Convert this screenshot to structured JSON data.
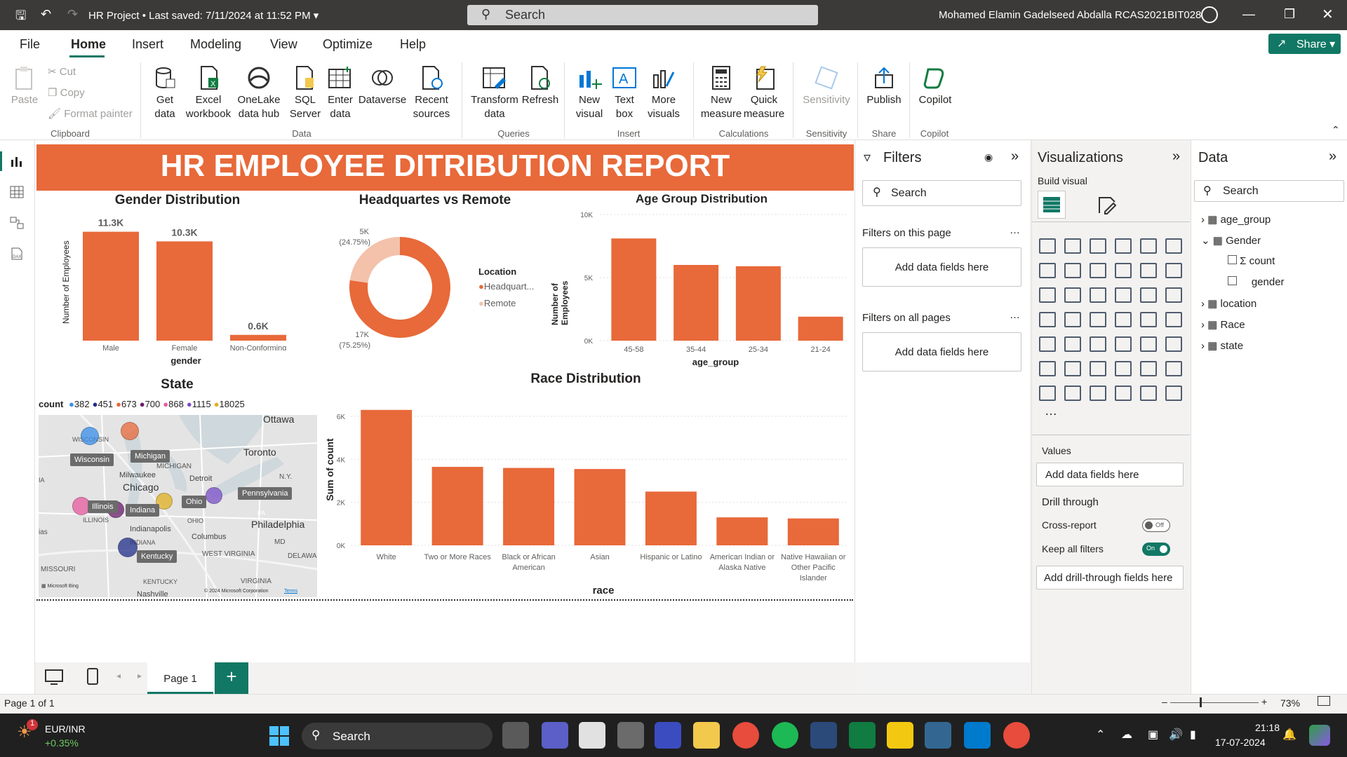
{
  "window": {
    "title": "HR Project",
    "saved": "Last saved: 7/11/2024 at 11:52 PM",
    "search_placeholder": "Search",
    "user": "Mohamed Elamin Gadelseed Abdalla RCAS2021BIT028"
  },
  "menu": {
    "items": [
      "File",
      "Home",
      "Insert",
      "Modeling",
      "View",
      "Optimize",
      "Help"
    ],
    "share": "Share"
  },
  "ribbon": {
    "clipboard": {
      "paste": "Paste",
      "cut": "Cut",
      "copy": "Copy",
      "format_painter": "Format painter",
      "label": "Clipboard"
    },
    "data": {
      "get_data": "Get data",
      "excel": "Excel workbook",
      "onelake": "OneLake data hub",
      "sql": "SQL Server",
      "enter": "Enter data",
      "dataverse": "Dataverse",
      "recent": "Recent sources",
      "label": "Data"
    },
    "queries": {
      "transform": "Transform data",
      "refresh": "Refresh",
      "label": "Queries"
    },
    "insert": {
      "new_visual": "New visual",
      "text_box": "Text box",
      "more_visuals": "More visuals",
      "label": "Insert"
    },
    "calculations": {
      "new_measure": "New measure",
      "quick_measure": "Quick measure",
      "label": "Calculations"
    },
    "sensitivity": {
      "sensitivity": "Sensitivity",
      "label": "Sensitivity"
    },
    "share": {
      "publish": "Publish",
      "label": "Share"
    },
    "copilot": {
      "copilot": "Copilot",
      "label": "Copilot"
    }
  },
  "report": {
    "title": "HR EMPLOYEE DITRIBUTION REPORT",
    "gender": {
      "title": "Gender Distribution",
      "ylabel": "Number of Employees",
      "xlabel": "gender",
      "labels": [
        "11.3K",
        "10.3K",
        "0.6K"
      ]
    },
    "hq": {
      "title": "Headquartes vs Remote",
      "legend_title": "Location",
      "legend": [
        "Headquart...",
        "Remote"
      ],
      "label_small": "5K",
      "label_small_pct": "(24.75%)",
      "label_big": "17K",
      "label_big_pct": "(75.25%)"
    },
    "age": {
      "title": "Age Group Distribution",
      "ylabel": "Number of Employees",
      "xlabel": "age_group",
      "ticks": [
        "10K",
        "5K",
        "0K"
      ]
    },
    "state": {
      "title": "State",
      "legend_title": "count",
      "legend": [
        "382",
        "451",
        "673",
        "700",
        "868",
        "1115",
        "18025"
      ],
      "legend_colors": [
        "#3a8ee8",
        "#1f2e8a",
        "#e8693a",
        "#6a1b6a",
        "#e85aa0",
        "#7b4fc9",
        "#e0b020"
      ],
      "places": {
        "ottawa": "Ottawa",
        "wisconsin_map": "WISCONSIN",
        "michigan_map": "MICHIGAN",
        "milwaukee": "Milwaukee",
        "chicago": "Chicago",
        "detroit": "Detroit",
        "toronto": "Toronto",
        "ny": "N.Y.",
        "illinois_map": "ILLINOIS",
        "indiana_map": "INDIANA",
        "indianapolis": "Indianapolis",
        "ohio_map": "OHIO",
        "columbus": "Columbus",
        "philadelphia": "Philadelphia",
        "pa": "PA",
        "md": "MD",
        "delaware": "DELAWAR",
        "west_virginia": "WEST VIRGINIA",
        "virginia": "VIRGINIA",
        "kentucky_map": "KENTUCKY",
        "missouri": "MISSOURI",
        "nashville": "Nashville",
        "ias": "ias",
        "ia": "IA",
        "bing": "Microsoft Bing",
        "copyright": "© 2024 Microsoft Corporation",
        "terms": "Terms"
      },
      "labels": {
        "wisconsin": "Wisconsin",
        "michigan": "Michigan",
        "illinois": "Illinois",
        "indiana": "Indiana",
        "ohio": "Ohio",
        "pennsylvania": "Pennsylvania",
        "kentucky": "Kentucky"
      }
    },
    "race": {
      "title": "Race Distribution",
      "ylabel": "Sum of count",
      "xlabel": "race",
      "ticks": [
        "6K",
        "4K",
        "2K",
        "0K"
      ]
    }
  },
  "chart_data": [
    {
      "type": "bar",
      "title": "Gender Distribution",
      "categories": [
        "Male",
        "Female",
        "Non-Conforming"
      ],
      "values": [
        11300,
        10300,
        600
      ],
      "xlabel": "gender",
      "ylabel": "Number of Employees"
    },
    {
      "type": "pie",
      "title": "Headquartes vs Remote",
      "categories": [
        "Headquart...",
        "Remote"
      ],
      "values": [
        17000,
        5000
      ],
      "colors": [
        "#e8693a",
        "#f4c1aa"
      ]
    },
    {
      "type": "bar",
      "title": "Age Group Distribution",
      "categories": [
        "45-58",
        "35-44",
        "25-34",
        "21-24"
      ],
      "values": [
        8100,
        6000,
        5900,
        1900
      ],
      "xlabel": "age_group",
      "ylabel": "Number of Employees",
      "ylim": [
        0,
        10000
      ]
    },
    {
      "type": "bar",
      "title": "Race Distribution",
      "categories": [
        "White",
        "Two or More Races",
        "Black or African American",
        "Asian",
        "Hispanic or Latino",
        "American Indian or Alaska Native",
        "Native Hawaiian or Other Pacific Islander"
      ],
      "values": [
        6300,
        3650,
        3600,
        3550,
        2500,
        1300,
        1250
      ],
      "xlabel": "race",
      "ylabel": "Sum of count",
      "ylim": [
        0,
        6000
      ]
    }
  ],
  "filters": {
    "title": "Filters",
    "search": "Search",
    "on_page": "Filters on this page",
    "add_fields": "Add data fields here",
    "on_all": "Filters on all pages"
  },
  "viz": {
    "title": "Visualizations",
    "build": "Build visual",
    "values": "Values",
    "add_fields": "Add data fields here",
    "drill": "Drill through",
    "cross": "Cross-report",
    "cross_state": "Off",
    "keep": "Keep all filters",
    "keep_state": "On",
    "add_drill": "Add drill-through fields here"
  },
  "data": {
    "title": "Data",
    "search": "Search",
    "tables": [
      "age_group",
      "Gender",
      "count",
      "gender",
      "location",
      "Race",
      "state"
    ]
  },
  "pages": {
    "page1": "Page 1",
    "status": "Page 1 of 1",
    "zoom": "73%"
  },
  "taskbar": {
    "ticker": "EUR/INR",
    "change": "+0.35%",
    "badge": "1",
    "search": "Search",
    "time": "21:18",
    "date": "17-07-2024"
  }
}
